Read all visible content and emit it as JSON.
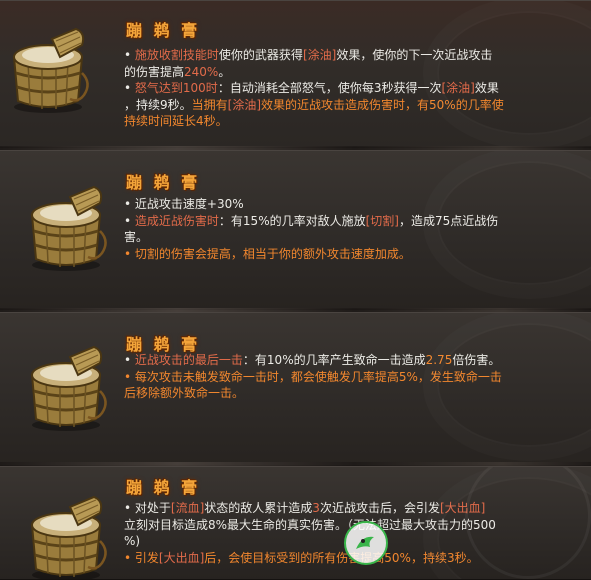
{
  "items": [
    {
      "title": "蹦 鹈 膏",
      "lines": [
        [
          {
            "t": "• "
          },
          {
            "t": "施放收割技能时",
            "c": "hl"
          },
          {
            "t": "使你的武器获得"
          },
          {
            "t": "[涂油]",
            "c": "bracket"
          },
          {
            "t": "效果，使你的下一次近战攻击"
          }
        ],
        [
          {
            "t": "的伤害提高"
          },
          {
            "t": "240%",
            "c": "hl"
          },
          {
            "t": "。"
          }
        ],
        [
          {
            "t": "• "
          },
          {
            "t": "怒气达到100时",
            "c": "hl"
          },
          {
            "t": "：自动消耗全部怒气，使你每3秒获得一次"
          },
          {
            "t": "[涂油]",
            "c": "bracket"
          },
          {
            "t": "效果"
          }
        ],
        [
          {
            "t": "，持续9秒。"
          },
          {
            "t": "当拥有",
            "c": "or"
          },
          {
            "t": "[涂油]",
            "c": "bracket"
          },
          {
            "t": "效果的近战攻击造成伤害时，有50%的几率使",
            "c": "or"
          }
        ],
        [
          {
            "t": "持续时间延长4秒。",
            "c": "or"
          }
        ]
      ]
    },
    {
      "title": "蹦 鹈 膏",
      "lines": [
        [
          {
            "t": "• 近战攻击速度+30%"
          }
        ],
        [
          {
            "t": "• "
          },
          {
            "t": "造成近战伤害时",
            "c": "hl"
          },
          {
            "t": "：有15%的几率对敌人施放"
          },
          {
            "t": "[切割]",
            "c": "bracket"
          },
          {
            "t": "，造成75点近战伤"
          }
        ],
        [
          {
            "t": "害。"
          }
        ],
        [
          {
            "t": "• 切割的伤害会提高，相当于你的额外攻击速度加成。",
            "c": "or"
          }
        ]
      ]
    },
    {
      "title": "蹦 鹈 膏",
      "lines": [
        [
          {
            "t": "• "
          },
          {
            "t": "近战攻击的最后一击",
            "c": "hl"
          },
          {
            "t": "：有10%的几率产生致命一击造成"
          },
          {
            "t": "2.75",
            "c": "or"
          },
          {
            "t": "倍伤害。"
          }
        ],
        [
          {
            "t": "• 每次攻击未触发致命一击时，都会使触发几率提高5%，发生致命一击",
            "c": "or"
          }
        ],
        [
          {
            "t": "后移除额外致命一击。",
            "c": "or"
          }
        ]
      ]
    },
    {
      "title": "蹦 鹈 膏",
      "lines": [
        [
          {
            "t": "• 对处于"
          },
          {
            "t": "[流血]",
            "c": "bracket"
          },
          {
            "t": "状态的敌人累计造成"
          },
          {
            "t": "3",
            "c": "hl"
          },
          {
            "t": "次近战攻击后，会引发"
          },
          {
            "t": "[大出血]",
            "c": "bracket"
          }
        ],
        [
          {
            "t": "立刻对目标造成8%最大生命的真实伤害。（无法超过最大攻击力的500"
          }
        ],
        [
          {
            "t": "%)"
          }
        ],
        [
          {
            "t": "• 引发",
            "c": "or"
          },
          {
            "t": "[大出血]",
            "c": "bracket"
          },
          {
            "t": "后，会使目标受到的所有伤害提高50%，持续3秒。",
            "c": "or"
          }
        ]
      ]
    }
  ],
  "icon": "wooden-bucket-icon",
  "colors": {
    "title": "#f4a53a",
    "highlight": "#e26b4a",
    "orange": "#f2872e",
    "text": "#ecebe6"
  }
}
